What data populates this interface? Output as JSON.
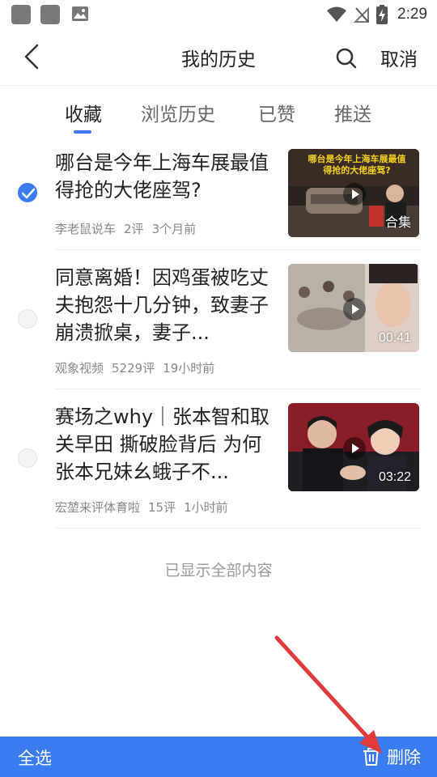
{
  "status_bar": {
    "time": "2:29"
  },
  "header": {
    "title": "我的历史",
    "cancel_label": "取消"
  },
  "tabs": [
    {
      "label": "收藏",
      "active": true
    },
    {
      "label": "浏览历史",
      "active": false
    },
    {
      "label": "已赞",
      "active": false
    },
    {
      "label": "推送",
      "active": false
    }
  ],
  "items": [
    {
      "title": "哪台是今年上海车展最值得抢的大佬座驾?",
      "source": "李老鼠说车",
      "comments": "2评",
      "time": "3个月前",
      "badge": "合集",
      "thumb_caption": "哪台是今年上海车展最值得抢的大佬座驾?",
      "checked": true
    },
    {
      "title": "同意离婚！因鸡蛋被吃丈夫抱怨十几分钟，致妻子崩溃掀桌，妻子...",
      "source": "观象视频",
      "comments": "5229评",
      "time": "19小时前",
      "badge": "00:41",
      "checked": false
    },
    {
      "title": "赛场之why｜张本智和取关早田 撕破脸背后 为何张本兄妹幺蛾子不...",
      "source": "宏堃来评体育啦",
      "comments": "15评",
      "time": "1小时前",
      "badge": "03:22",
      "checked": false
    }
  ],
  "end_text": "已显示全部内容",
  "bottom_bar": {
    "select_all_label": "全选",
    "delete_label": "删除"
  },
  "colors": {
    "accent": "#3a7bf0",
    "annotation_arrow": "#e03a3a"
  }
}
